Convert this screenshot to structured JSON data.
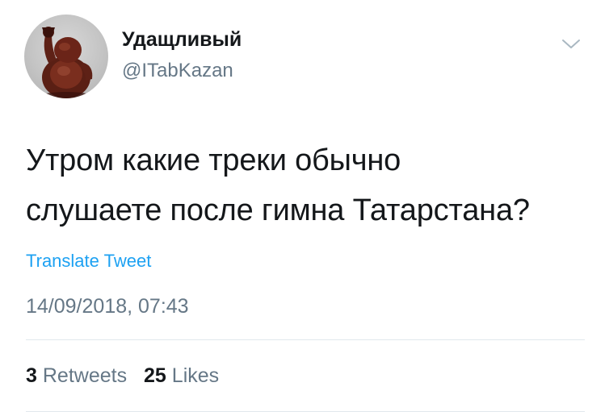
{
  "author": {
    "display_name": "Удащливый",
    "handle": "@ITabKazan",
    "avatar_icon": "laughing-buddha-statue-avatar"
  },
  "tweet": {
    "text_lines": [
      "Утром какие треки обычно",
      "слушаете после гимна Татарстана?"
    ],
    "translate_label": "Translate Tweet",
    "timestamp": "14/09/2018, 07:43"
  },
  "stats": {
    "retweets_count": "3",
    "retweets_label": "Retweets",
    "likes_count": "25",
    "likes_label": "Likes"
  },
  "menu": {
    "caret_icon": "chevron-down-icon"
  },
  "colors": {
    "text_primary": "#14171a",
    "text_secondary": "#657786",
    "link": "#1da1f2",
    "divider": "#e1e8ed",
    "background": "#ffffff"
  }
}
